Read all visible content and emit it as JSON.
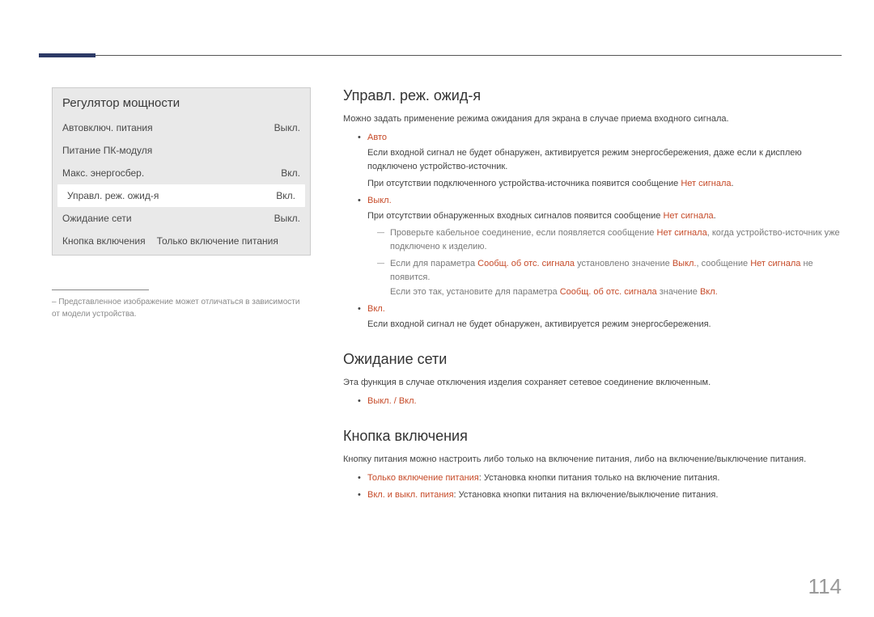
{
  "pageNumber": "114",
  "panel": {
    "title": "Регулятор мощности",
    "rows": [
      {
        "label": "Автовключ. питания",
        "value": "Выкл."
      },
      {
        "label": "Питание ПК-модуля",
        "value": ""
      },
      {
        "label": "Макс. энергосбер.",
        "value": "Вкл."
      },
      {
        "label": "Управл. реж. ожид-я",
        "value": "Вкл."
      },
      {
        "label": "Ожидание сети",
        "value": "Выкл."
      }
    ],
    "lastRow": {
      "label": "Кнопка включения",
      "value": "Только включение питания"
    }
  },
  "footnote": "– Представленное изображение может отличаться в зависимости от модели устройства.",
  "sections": {
    "standby": {
      "title": "Управл. реж. ожид-я",
      "intro": "Можно задать применение режима ожидания для экрана в случае приема входного сигнала.",
      "auto": {
        "label": "Авто",
        "desc1": "Если входной сигнал не будет обнаружен, активируется режим энергосбережения, даже если к дисплею подключено устройство-источник.",
        "desc2_a": "При отсутствии подключенного устройства-источника появится сообщение ",
        "desc2_b": "Нет сигнала",
        "desc2_c": "."
      },
      "off": {
        "label": "Выкл.",
        "desc1_a": "При отсутствии обнаруженных входных сигналов появится сообщение ",
        "desc1_b": "Нет сигнала",
        "desc1_c": ".",
        "dash1_a": "Проверьте кабельное соединение, если появляется сообщение ",
        "dash1_b": "Нет сигнала",
        "dash1_c": ", когда устройство-источник уже подключено к изделию.",
        "dash2_a": "Если для параметра ",
        "dash2_b": "Сообщ. об отс. сигнала",
        "dash2_c": " установлено значение ",
        "dash2_d": "Выкл.",
        "dash2_e": ", сообщение ",
        "dash2_f": "Нет сигнала",
        "dash2_g": " не появится.",
        "dash2_h": "Если это так, установите для параметра ",
        "dash2_i": "Сообщ. об отс. сигнала",
        "dash2_j": " значение ",
        "dash2_k": "Вкл."
      },
      "on": {
        "label": "Вкл.",
        "desc": "Если входной сигнал не будет обнаружен, активируется режим энергосбережения."
      }
    },
    "netStandby": {
      "title": "Ожидание сети",
      "intro": "Эта функция в случае отключения изделия сохраняет сетевое соединение включенным.",
      "opt": "Выкл. / Вкл."
    },
    "powerBtn": {
      "title": "Кнопка включения",
      "intro": "Кнопку питания можно настроить либо только на включение питания, либо на включение/выключение питания.",
      "opt1_label": "Только включение питания",
      "opt1_desc": ": Установка кнопки питания только на включение питания.",
      "opt2_label": "Вкл. и выкл. питания",
      "opt2_desc": ": Установка кнопки питания на включение/выключение питания."
    }
  }
}
